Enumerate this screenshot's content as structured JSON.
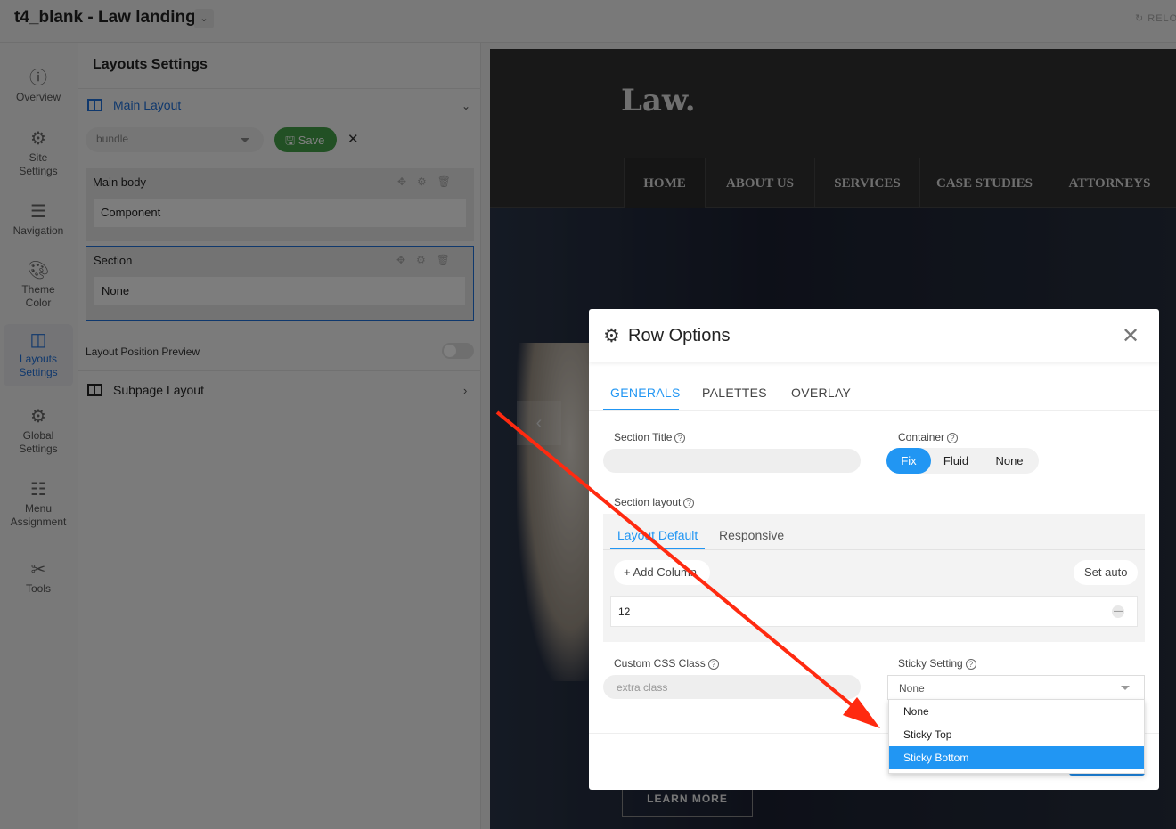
{
  "app": {
    "title": "t4_blank - Law landing",
    "reload": "RELOAD"
  },
  "sidebar": {
    "items": [
      {
        "label": "Overview",
        "icon": "info-icon"
      },
      {
        "label": "Site Settings",
        "icon": "gear-icon"
      },
      {
        "label": "Navigation",
        "icon": "menu-icon"
      },
      {
        "label": "Theme Color",
        "icon": "palette-icon"
      },
      {
        "label": "Layouts Settings",
        "icon": "layout-icon"
      },
      {
        "label": "Global Settings",
        "icon": "gears-icon"
      },
      {
        "label": "Menu Assignment",
        "icon": "list-icon"
      },
      {
        "label": "Tools",
        "icon": "tools-icon"
      }
    ]
  },
  "panel": {
    "title": "Layouts Settings",
    "main_layout": "Main Layout",
    "bundle_value": "bundle",
    "save_label": "Save",
    "rows": [
      {
        "name": "Main body",
        "content": "Component"
      },
      {
        "name": "Section",
        "content": "None"
      }
    ],
    "layout_position_preview": "Layout Position Preview",
    "subpage_layout": "Subpage Layout"
  },
  "preview": {
    "logo": "Law.",
    "nav": [
      "HOME",
      "ABOUT US",
      "SERVICES",
      "CASE STUDIES",
      "ATTORNEYS"
    ],
    "learn_more": "LEARN MORE"
  },
  "modal": {
    "title": "Row Options",
    "tabs": [
      "GENERALS",
      "PALETTES",
      "OVERLAY"
    ],
    "section_title_label": "Section Title",
    "container_label": "Container",
    "container_options": [
      "Fix",
      "Fluid",
      "None"
    ],
    "container_selected": "Fix",
    "section_layout_label": "Section layout",
    "layout_tabs": [
      "Layout Default",
      "Responsive"
    ],
    "add_column": "Add Column",
    "set_auto": "Set auto",
    "column_value": "12",
    "custom_css_label": "Custom CSS Class",
    "custom_css_placeholder": "extra class",
    "sticky_label": "Sticky Setting",
    "sticky_value": "None",
    "sticky_options": [
      "None",
      "Sticky Top",
      "Sticky Bottom"
    ],
    "sticky_highlighted": "Sticky Bottom"
  },
  "colors": {
    "accent": "#2196f3",
    "save": "#43a047",
    "annotation_arrow": "#ff2a10"
  }
}
